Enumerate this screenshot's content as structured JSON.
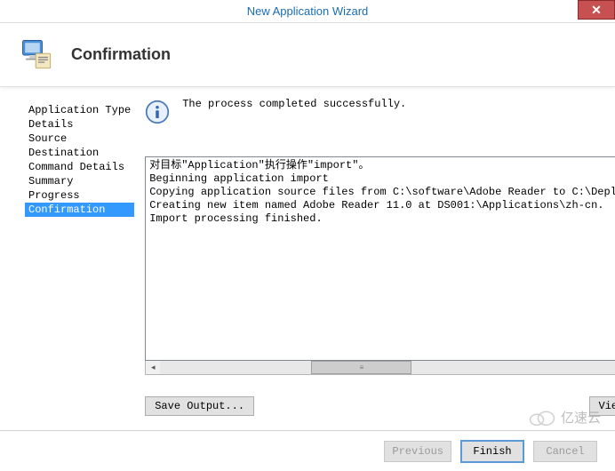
{
  "window": {
    "title": "New Application Wizard"
  },
  "header": {
    "title": "Confirmation"
  },
  "sidebar": {
    "items": [
      {
        "label": "Application Type",
        "active": false
      },
      {
        "label": "Details",
        "active": false
      },
      {
        "label": "Source",
        "active": false
      },
      {
        "label": "Destination",
        "active": false
      },
      {
        "label": "Command Details",
        "active": false
      },
      {
        "label": "Summary",
        "active": false
      },
      {
        "label": "Progress",
        "active": false
      },
      {
        "label": "Confirmation",
        "active": true
      }
    ]
  },
  "status": {
    "message": "The process completed successfully."
  },
  "log": {
    "lines": [
      "对目标\"Application\"执行操作\"import\"。",
      "Beginning application import",
      "Copying application source files from C:\\software\\Adobe Reader to C:\\DeploymentSha",
      "Creating new item named Adobe Reader 11.0 at DS001:\\Applications\\zh-cn.",
      "Import processing finished."
    ]
  },
  "actions": {
    "save_output": "Save Output...",
    "view_script": "View Script"
  },
  "footer": {
    "previous": "Previous",
    "finish": "Finish",
    "cancel": "Cancel"
  },
  "watermark": {
    "text": "亿速云"
  }
}
